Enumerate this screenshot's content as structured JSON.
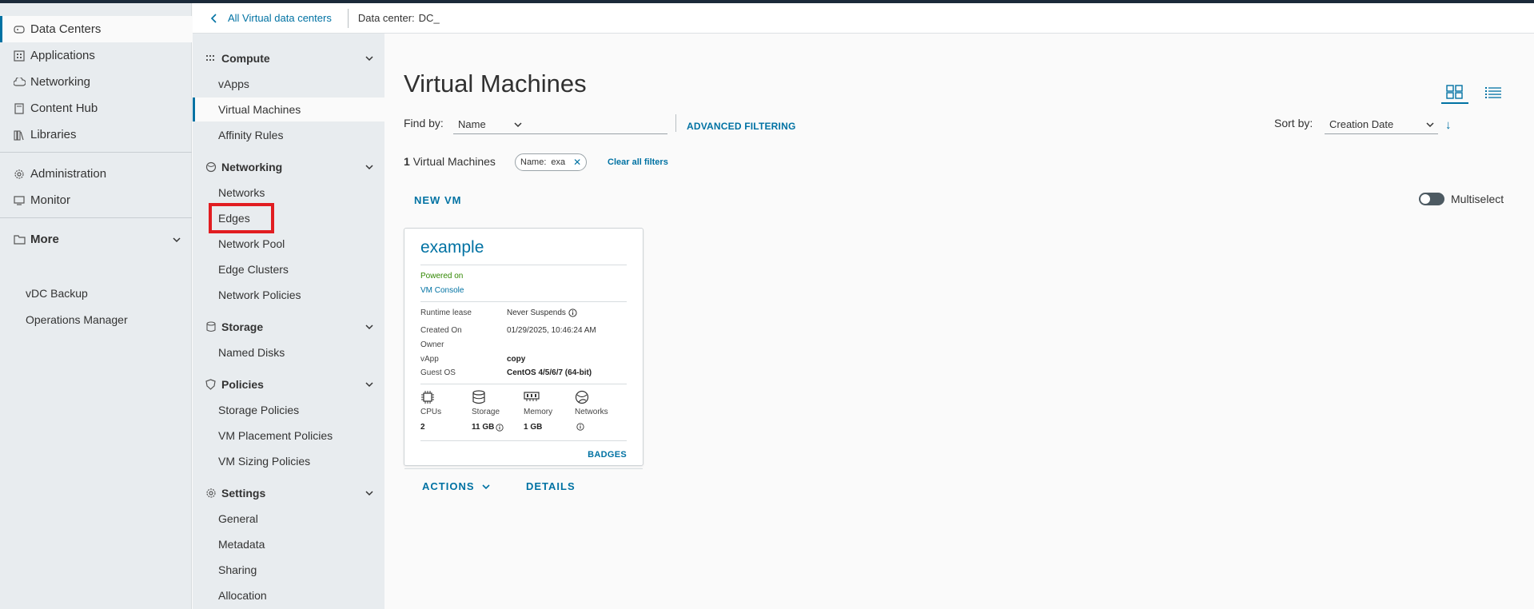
{
  "leftnav": {
    "items": [
      {
        "label": "Data Centers",
        "icon": "datacenter-icon",
        "active": true
      },
      {
        "label": "Applications",
        "icon": "applications-icon"
      },
      {
        "label": "Networking",
        "icon": "cloud-icon"
      },
      {
        "label": "Content Hub",
        "icon": "content-hub-icon"
      },
      {
        "label": "Libraries",
        "icon": "libraries-icon"
      }
    ],
    "admin": [
      {
        "label": "Administration",
        "icon": "gear-icon"
      },
      {
        "label": "Monitor",
        "icon": "monitor-icon"
      }
    ],
    "more": {
      "label": "More",
      "items": [
        "vDC Backup",
        "Operations Manager"
      ]
    }
  },
  "crumb": {
    "back_label": "All Virtual data centers",
    "dc_label": "Data center:",
    "dc_value": "DC_"
  },
  "subnav": {
    "compute": {
      "label": "Compute",
      "items": [
        "vApps",
        "Virtual Machines",
        "Affinity Rules"
      ]
    },
    "networking": {
      "label": "Networking",
      "items": [
        "Networks",
        "Edges",
        "Network Pool",
        "Edge Clusters",
        "Network Policies"
      ]
    },
    "storage": {
      "label": "Storage",
      "items": [
        "Named Disks"
      ]
    },
    "policies": {
      "label": "Policies",
      "items": [
        "Storage Policies",
        "VM Placement Policies",
        "VM Sizing Policies"
      ]
    },
    "settings": {
      "label": "Settings",
      "items": [
        "General",
        "Metadata",
        "Sharing",
        "Allocation"
      ]
    }
  },
  "main": {
    "title": "Virtual Machines",
    "find_by_label": "Find by:",
    "find_by_value": "Name",
    "advanced_filtering": "ADVANCED FILTERING",
    "sort_by_label": "Sort by:",
    "sort_by_value": "Creation Date",
    "count_num": "1",
    "count_label": "Virtual Machines",
    "chip_key": "Name:",
    "chip_value": "exa",
    "clear_filters": "Clear all filters",
    "new_vm": "NEW VM",
    "multiselect": "Multiselect"
  },
  "card": {
    "name": "example",
    "status": "Powered on",
    "console": "VM Console",
    "rows": [
      {
        "k": "Runtime lease",
        "v": "Never Suspends"
      },
      {
        "k": "Created On",
        "v": "01/29/2025, 10:46:24 AM"
      },
      {
        "k": "Owner",
        "v": ""
      },
      {
        "k": "vApp",
        "v": "copy"
      },
      {
        "k": "Guest OS",
        "v": "CentOS 4/5/6/7 (64-bit)"
      }
    ],
    "resources": [
      {
        "label": "CPUs",
        "value": "2"
      },
      {
        "label": "Storage",
        "value": "11 GB"
      },
      {
        "label": "Memory",
        "value": "1 GB"
      },
      {
        "label": "Networks",
        "value": ""
      }
    ],
    "badges": "BADGES",
    "actions": "ACTIONS",
    "details": "DETAILS"
  },
  "colors": {
    "accent": "#0072a3",
    "highlight": "#e11d21",
    "powered_on": "#318700"
  }
}
